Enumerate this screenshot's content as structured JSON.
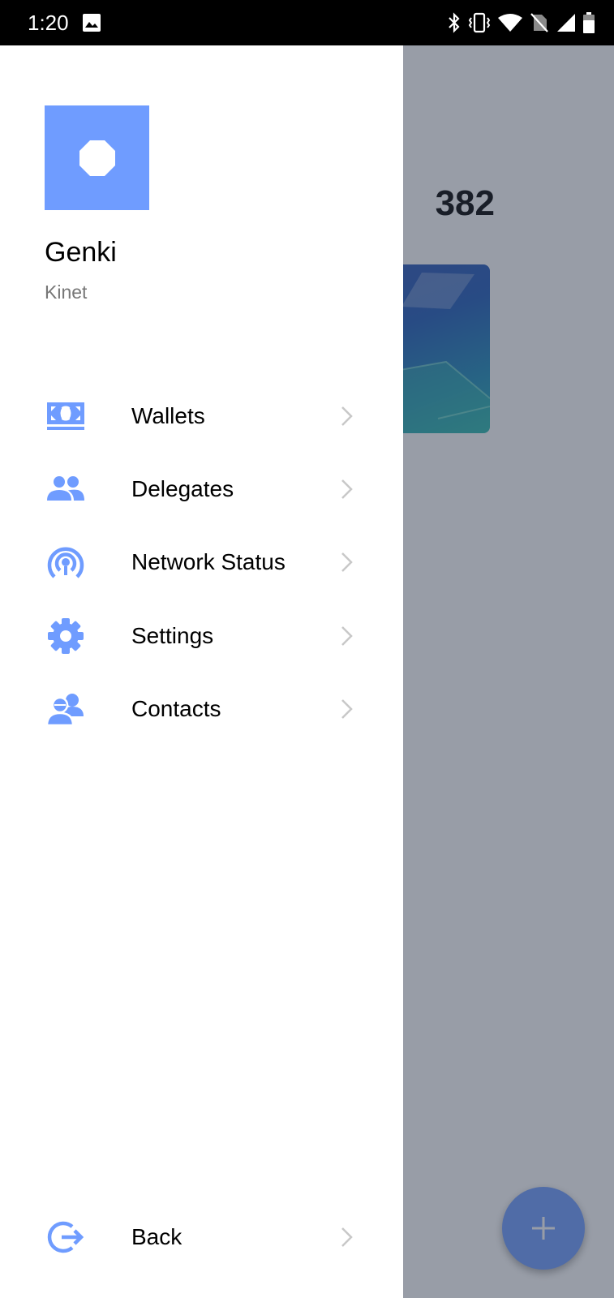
{
  "status_bar": {
    "time": "1:20",
    "icons": [
      "gallery-icon",
      "bluetooth-icon",
      "vibrate-icon",
      "wifi-icon",
      "no-sim-icon",
      "signal-icon",
      "battery-icon"
    ]
  },
  "background": {
    "balance_partial": "382",
    "fab_label": "+"
  },
  "profile": {
    "name": "Genki",
    "network": "Kinet"
  },
  "menu": {
    "items": [
      {
        "label": "Wallets",
        "icon": "wallet-icon"
      },
      {
        "label": "Delegates",
        "icon": "delegates-icon"
      },
      {
        "label": "Network Status",
        "icon": "network-status-icon"
      },
      {
        "label": "Settings",
        "icon": "settings-gear-icon"
      },
      {
        "label": "Contacts",
        "icon": "contacts-icon"
      }
    ],
    "back": {
      "label": "Back",
      "icon": "back-exit-icon"
    }
  },
  "colors": {
    "accent": "#6f9cff",
    "status_bar": "#000000",
    "scrim": "#5a6478",
    "chevron": "#c8c8c8"
  }
}
